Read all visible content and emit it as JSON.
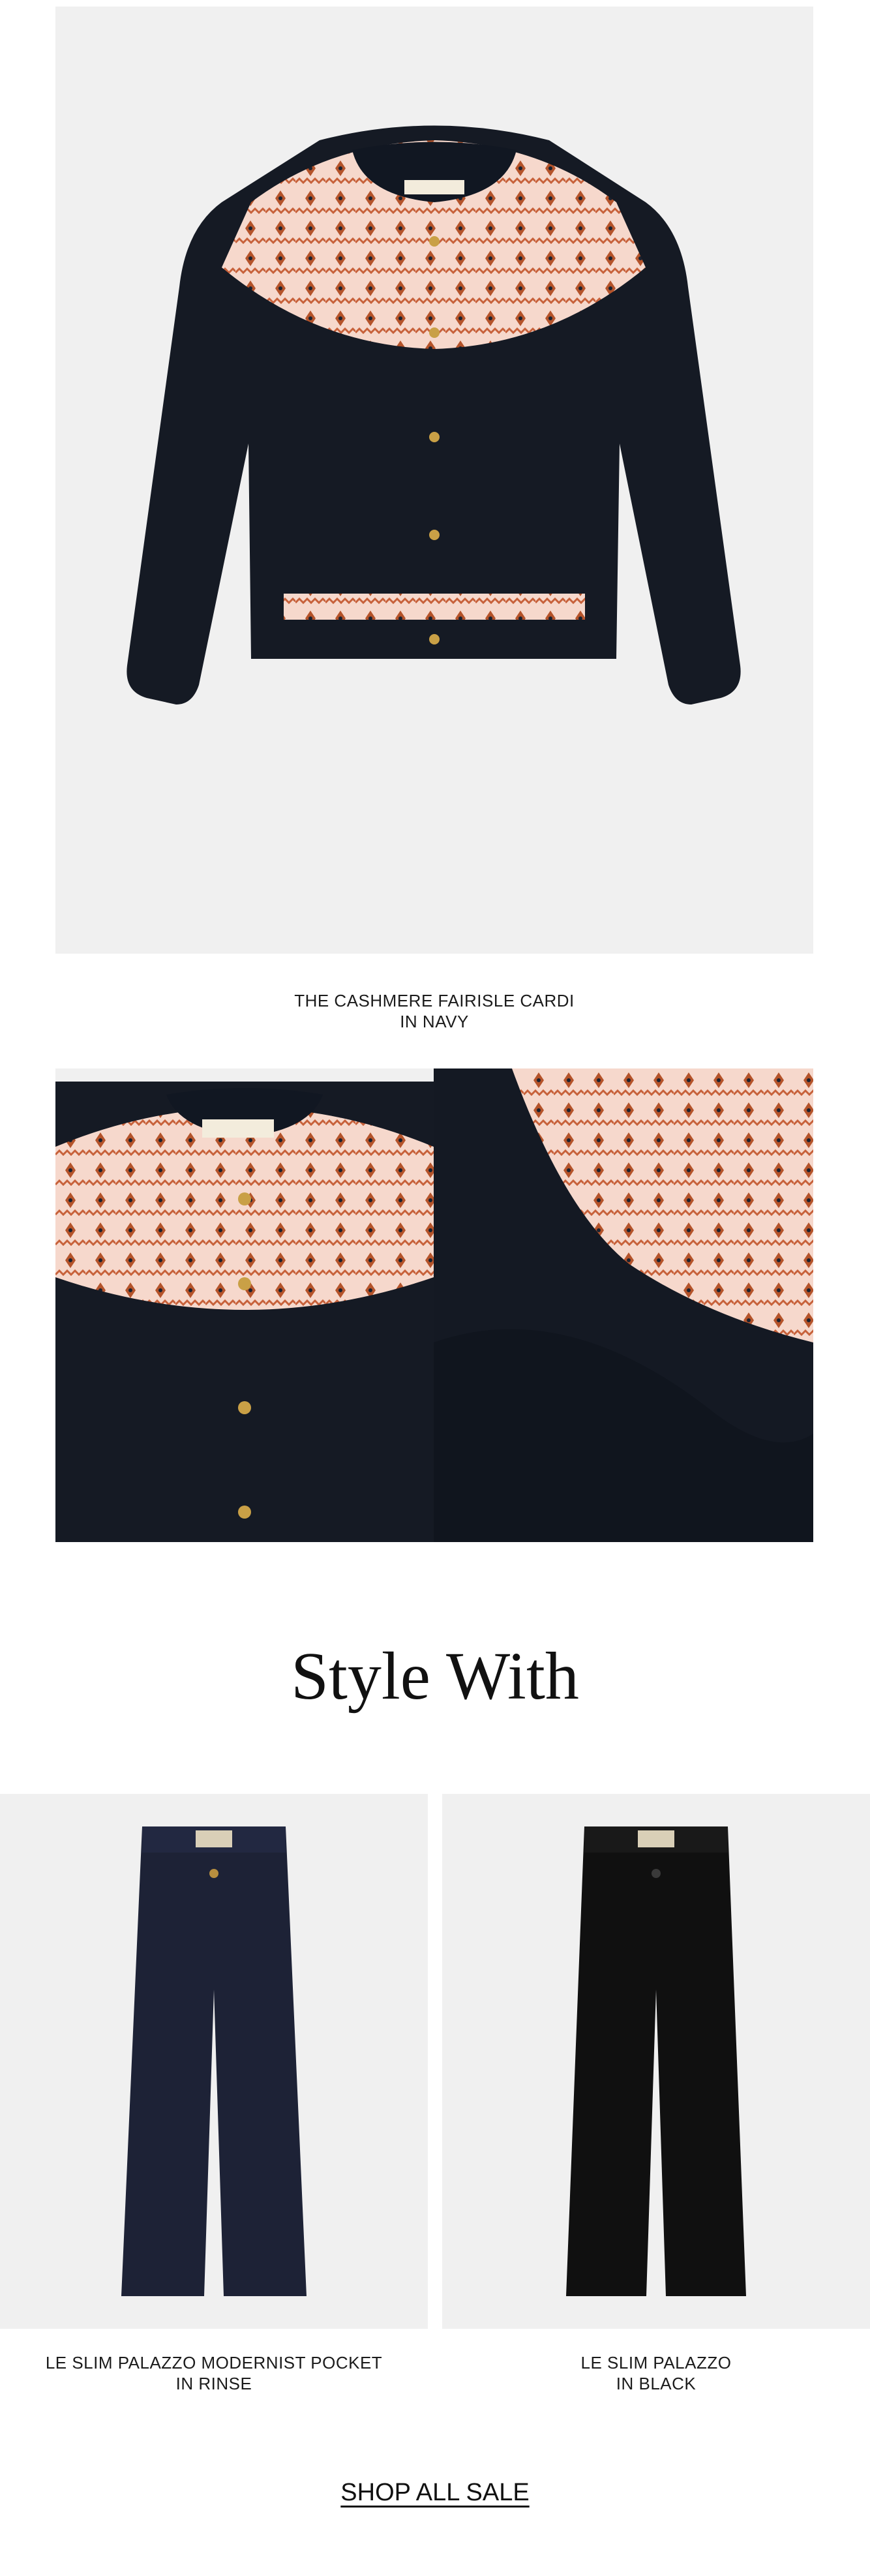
{
  "hero": {
    "product_name": "THE CASHMERE FAIRISLE CARDI",
    "color": "IN NAVY"
  },
  "section": {
    "title": "Style With"
  },
  "style_with": [
    {
      "name": "LE SLIM PALAZZO MODERNIST POCKET",
      "color": "IN RINSE"
    },
    {
      "name": "LE SLIM PALAZZO",
      "color": "IN BLACK"
    }
  ],
  "footer": {
    "cta": "SHOP ALL SALE"
  }
}
